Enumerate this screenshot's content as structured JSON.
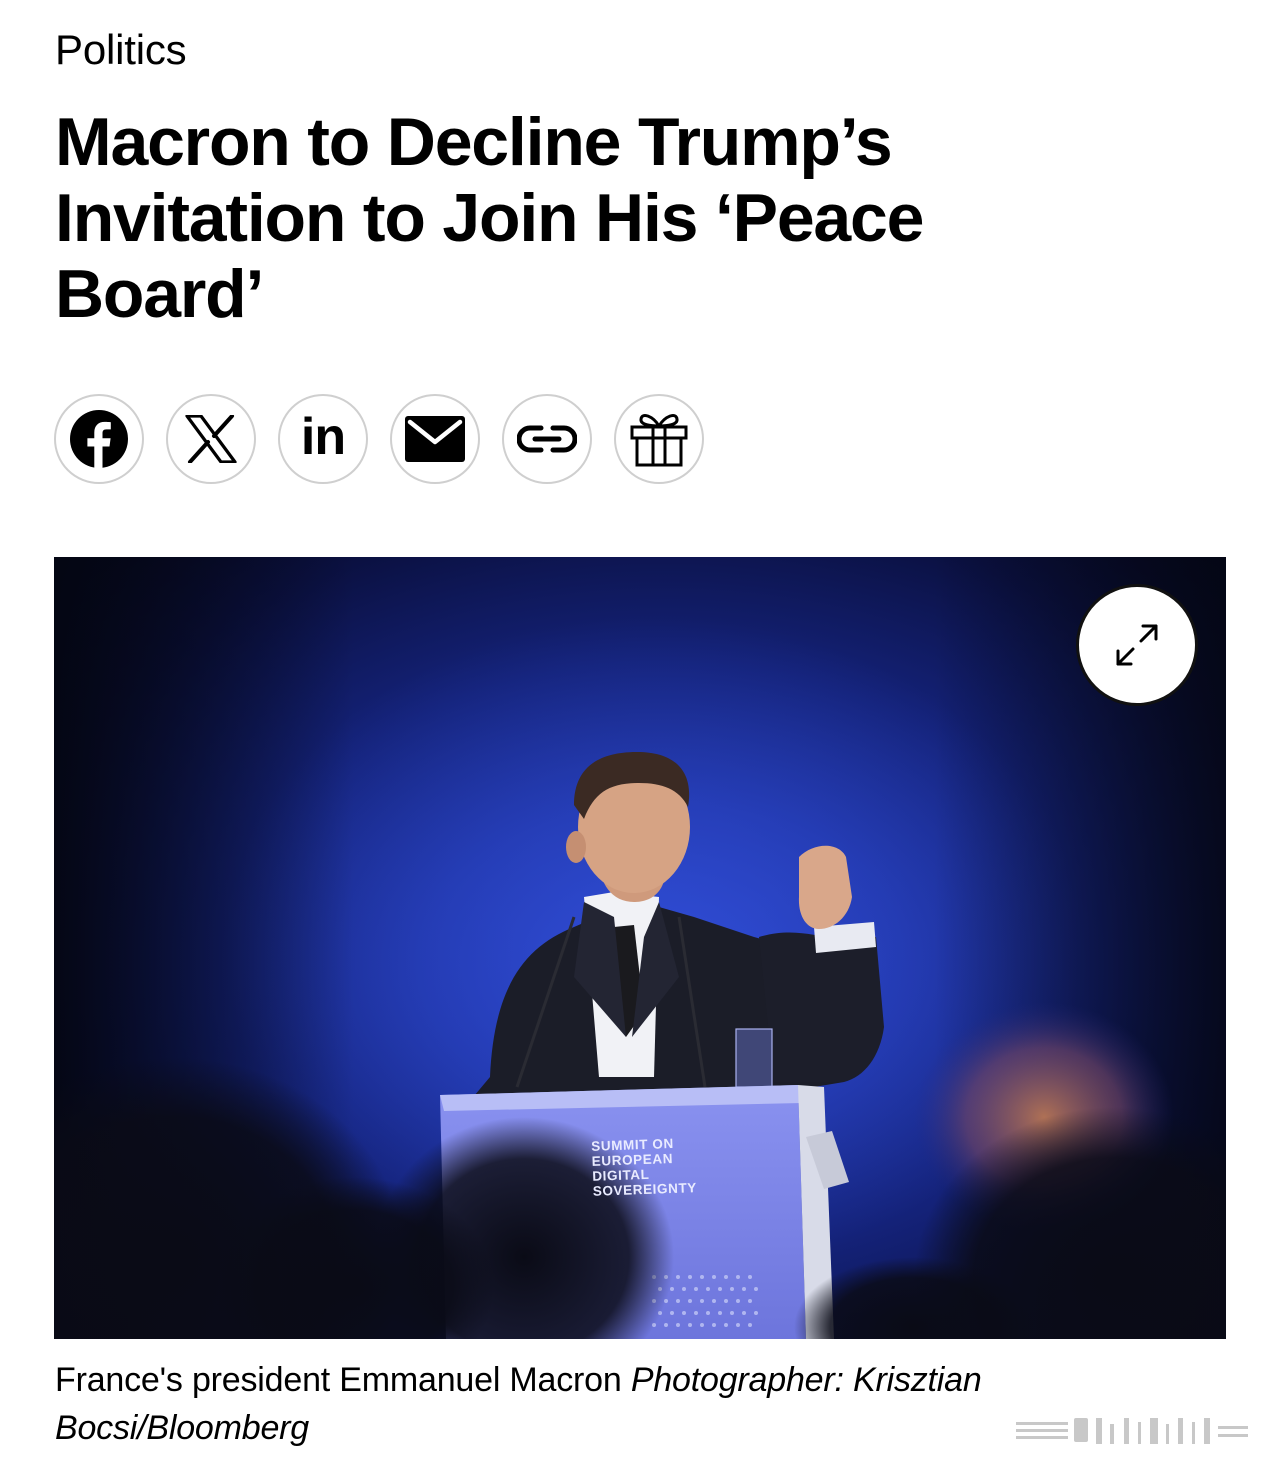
{
  "section": "Politics",
  "headline": {
    "line1": "Macron to Decline Trump’s",
    "line2": "Invitation to Join His ‘Peace",
    "line3": "Board’"
  },
  "share": {
    "buttons": [
      {
        "name": "facebook",
        "icon": "facebook-icon"
      },
      {
        "name": "x",
        "icon": "x-icon"
      },
      {
        "name": "linkedin",
        "icon": "linkedin-icon",
        "text": "in"
      },
      {
        "name": "email",
        "icon": "mail-icon"
      },
      {
        "name": "copy-link",
        "icon": "link-icon"
      },
      {
        "name": "gift",
        "icon": "gift-icon"
      }
    ]
  },
  "hero": {
    "expand_icon": "expand-arrows-icon",
    "podium_lines": [
      "SUMMIT ON",
      "EUROPEAN",
      "DIGITAL",
      "SOVEREIGNTY"
    ],
    "colors": {
      "backdrop": "#1f34a6",
      "podium": "#7d86e8"
    }
  },
  "caption": {
    "text": "France's president Emmanuel Macron",
    "credit": "Photographer: Krisztian Bocsi/Bloomberg"
  }
}
